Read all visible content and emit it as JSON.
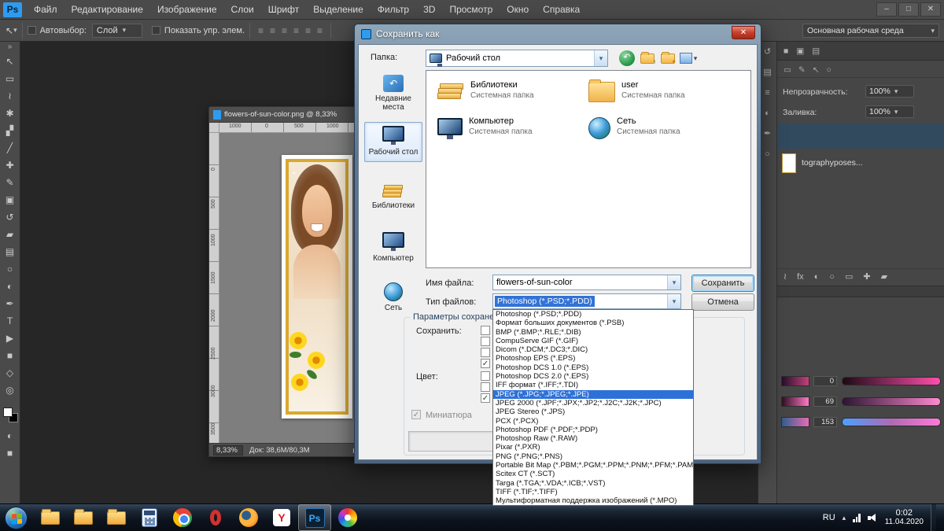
{
  "glyphs": {
    "caret": "▾",
    "check": "✓",
    "minimize": "–",
    "restore": "□",
    "close": "✕",
    "chevrons": "»",
    "back": "↶",
    "up": "↑",
    "new_folder_star": "✦",
    "play": "▶",
    "tray_up": "▴",
    "align": "≡"
  },
  "app": {
    "logo": "Ps",
    "menu": [
      "Файл",
      "Редактирование",
      "Изображение",
      "Слои",
      "Шрифт",
      "Выделение",
      "Фильтр",
      "3D",
      "Просмотр",
      "Окно",
      "Справка"
    ]
  },
  "options_bar": {
    "autoselect_label": "Автовыбор:",
    "autoselect_value": "Слой",
    "show_controls_label": "Показать упр. элем.",
    "workspace_value": "Основная рабочая среда"
  },
  "tools": [
    {
      "name": "move",
      "glyph": "↖"
    },
    {
      "name": "marquee",
      "glyph": "▭"
    },
    {
      "name": "lasso",
      "glyph": "≀"
    },
    {
      "name": "quick-selection",
      "glyph": "✱"
    },
    {
      "name": "crop",
      "glyph": "▞"
    },
    {
      "name": "eyedropper",
      "glyph": "╱"
    },
    {
      "name": "healing-brush",
      "glyph": "✚"
    },
    {
      "name": "brush",
      "glyph": "✎"
    },
    {
      "name": "clone-stamp",
      "glyph": "▣"
    },
    {
      "name": "history-brush",
      "glyph": "↺"
    },
    {
      "name": "eraser",
      "glyph": "▰"
    },
    {
      "name": "gradient",
      "glyph": "▤"
    },
    {
      "name": "blur",
      "glyph": "○"
    },
    {
      "name": "dodge",
      "glyph": "◐"
    },
    {
      "name": "pen",
      "glyph": "✒"
    },
    {
      "name": "type",
      "glyph": "T"
    },
    {
      "name": "path-selection",
      "glyph": "▶"
    },
    {
      "name": "shape",
      "glyph": "■"
    },
    {
      "name": "hand",
      "glyph": "◇"
    },
    {
      "name": "zoom",
      "glyph": "◎"
    }
  ],
  "document": {
    "title": "flowers-of-sun-color.png @ 8,33%",
    "h_ruler": [
      "1000",
      "0",
      "500",
      "1000"
    ],
    "v_ruler": [
      "0",
      "500",
      "1000",
      "1500",
      "2000",
      "2500",
      "3000",
      "3500"
    ],
    "zoom": "8,33%",
    "doc_info": "Док: 38,6M/80,3M"
  },
  "right_panel": {
    "opacity_label": "Непрозрачность:",
    "opacity_value": "100%",
    "fill_label": "Заливка:",
    "fill_value": "100%",
    "layer_name": "tographyposes...",
    "fx_label": "fx",
    "color_values": [
      "0",
      "69",
      "153"
    ]
  },
  "dialog": {
    "title": "Сохранить как",
    "folder_label": "Папка:",
    "folder_value": "Рабочий стол",
    "places": [
      {
        "label": "Недавние места"
      },
      {
        "label": "Рабочий стол"
      },
      {
        "label": "Библиотеки"
      },
      {
        "label": "Компьютер"
      },
      {
        "label": "Сеть"
      }
    ],
    "files": [
      {
        "name": "Библиотеки",
        "type": "Системная папка"
      },
      {
        "name": "user",
        "type": "Системная папка"
      },
      {
        "name": "Компьютер",
        "type": "Системная папка"
      },
      {
        "name": "Сеть",
        "type": "Системная папка"
      }
    ],
    "filename_label": "Имя файла:",
    "filename_value": "flowers-of-sun-color",
    "filetype_label": "Тип файлов:",
    "filetype_value": "Photoshop (*.PSD;*.PDD)",
    "save_button": "Сохранить",
    "cancel_button": "Отмена",
    "options_group_label": "Параметры сохранени",
    "save_section_label": "Сохранить:",
    "color_section_label": "Цвет:",
    "thumbnail_label": "Миниатюра",
    "format_options": [
      "Photoshop (*.PSD;*.PDD)",
      "Формат больших документов (*.PSB)",
      "BMP (*.BMP;*.RLE;*.DIB)",
      "CompuServe GIF (*.GIF)",
      "Dicom (*.DCM;*.DC3;*.DIC)",
      "Photoshop EPS (*.EPS)",
      "Photoshop DCS 1.0 (*.EPS)",
      "Photoshop DCS 2.0 (*.EPS)",
      "IFF формат (*.IFF;*.TDI)",
      "JPEG (*.JPG;*.JPEG;*.JPE)",
      "JPEG 2000 (*.JPF;*.JPX;*.JP2;*.J2C;*.J2K;*.JPC)",
      "JPEG Stereo (*.JPS)",
      "PCX (*.PCX)",
      "Photoshop PDF (*.PDF;*.PDP)",
      "Photoshop Raw (*.RAW)",
      "Pixar (*.PXR)",
      "PNG (*.PNG;*.PNS)",
      "Portable Bit Map (*.PBM;*.PGM;*.PPM;*.PNM;*.PFM;*.PAM)",
      "Scitex CT (*.SCT)",
      "Targa (*.TGA;*.VDA;*.ICB;*.VST)",
      "TIFF (*.TIF;*.TIFF)",
      "Мультиформатная поддержка изображений  (*.MPO)"
    ],
    "selected_format": "JPEG (*.JPG;*.JPEG;*.JPE)"
  },
  "taskbar": {
    "language": "RU",
    "yandex_letter": "Y",
    "time": "0:02",
    "date": "11.04.2020"
  }
}
